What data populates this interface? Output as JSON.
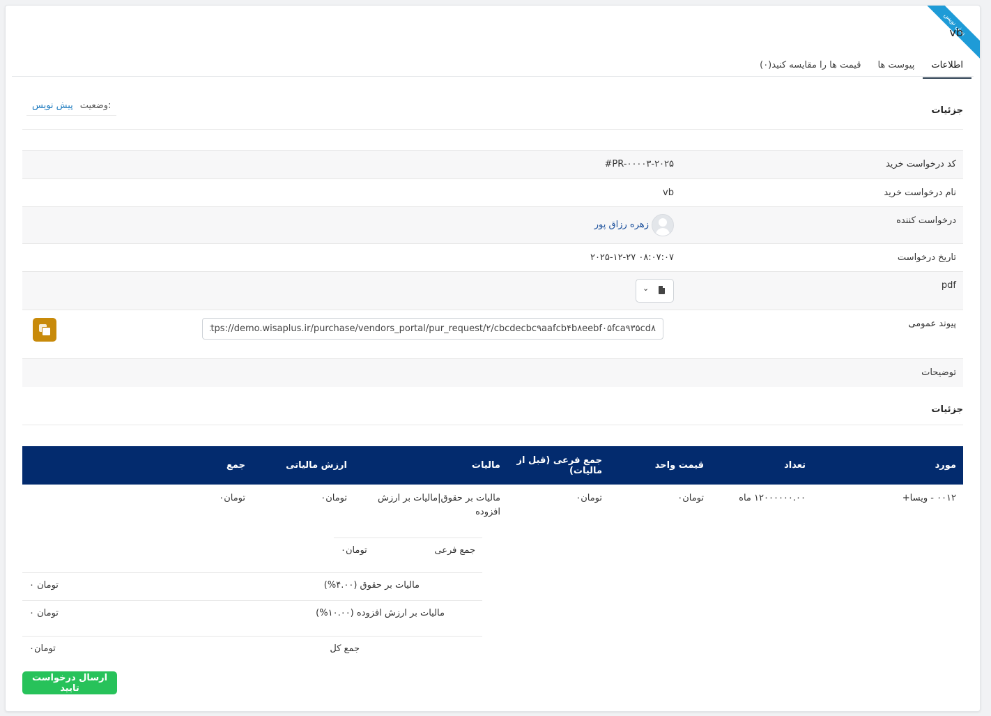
{
  "ribbon": "پیش نویس",
  "title": "vb",
  "tabs": [
    {
      "label": "اطلاعات",
      "active": true
    },
    {
      "label": "پیوست ها",
      "active": false
    },
    {
      "label": "قیمت ها را مقایسه کنید(۰)",
      "active": false
    }
  ],
  "details_section_title": "جزئیات",
  "status": {
    "label": "وضعیت:",
    "value": "پیش نویس"
  },
  "fields": {
    "code": {
      "label": "کد درخواست خرید",
      "value": "#PR-۰۰۰۰۳-۲۰۲۵"
    },
    "name": {
      "label": "نام درخواست خرید",
      "value": "vb"
    },
    "requester": {
      "label": "درخواست کننده",
      "value": "زهره رزاق پور"
    },
    "date": {
      "label": "تاریخ درخواست",
      "value": "۲۰۲۵-۱۲-۲۷ ۰۸:۰۷:۰۷"
    },
    "pdf": {
      "label": "pdf"
    },
    "public_link": {
      "label": "پیوند عمومی",
      "value": "https://demo.wisaplus.ir/purchase/vendors_portal/pur_request/۲/cbcdecbc۹aafcb۴b۸eebf۰۵fca۹۳۵cd۸"
    },
    "notes": {
      "label": "توضیحات"
    }
  },
  "items_section_title": "جزئیات",
  "table": {
    "headers": [
      "مورد",
      "تعداد",
      "قیمت واحد",
      "جمع فرعی (قبل از مالیات)",
      "مالیات",
      "ارزش مالیاتی",
      "جمع"
    ],
    "rows": [
      {
        "item": "۰۰۱۲ - ویسا+",
        "qty": "۱۲۰۰۰۰۰۰.۰۰ ماه",
        "unit_price": "تومان۰",
        "subtotal": "تومان۰",
        "tax": "مالیات بر حقوق|مالیات بر ارزش افزوده",
        "tax_value": "تومان۰",
        "total": "تومان۰"
      }
    ]
  },
  "totals": {
    "subtotal": {
      "label": "جمع فرعی",
      "value": "تومان۰"
    },
    "salary_tax": {
      "label": "مالیات بر حقوق (۴.۰۰%)",
      "value": "۰ تومان"
    },
    "vat": {
      "label": "مالیات بر ارزش افزوده (۱۰.۰۰%)",
      "value": "۰ تومان"
    },
    "grand_total": {
      "label": "جمع کل",
      "value": "تومان۰"
    }
  },
  "submit_label": "ارسال درخواست تایید",
  "colors": {
    "table_header": "#032b6e",
    "submit": "#27c25a",
    "copy": "#c88a0a",
    "ribbon": "#1e9bd7"
  },
  "icons": [
    "pdf-file-icon",
    "chevron-down-icon",
    "copy-icon",
    "user-avatar-icon"
  ]
}
